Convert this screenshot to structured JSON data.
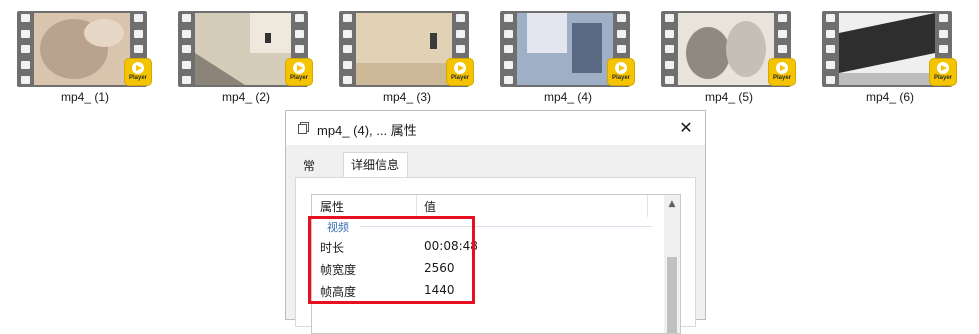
{
  "files": [
    {
      "name": "mp4_ (1)",
      "frame_colors": [
        "#d9c4ae",
        "#b9a38f",
        "#e6d7c6"
      ]
    },
    {
      "name": "mp4_ (2)",
      "frame_colors": [
        "#d6ccba",
        "#8c8478",
        "#efe8dc"
      ]
    },
    {
      "name": "mp4_ (3)",
      "frame_colors": [
        "#e1d1b5",
        "#cdb998",
        "#3b3b3b"
      ]
    },
    {
      "name": "mp4_ (4)",
      "frame_colors": [
        "#9fb0c6",
        "#e3e6ee",
        "#5a6a84"
      ]
    },
    {
      "name": "mp4_ (5)",
      "frame_colors": [
        "#e9e4da",
        "#8f8a80",
        "#c5c0b6"
      ]
    },
    {
      "name": "mp4_ (6)",
      "frame_colors": [
        "#2e2e2e",
        "#efefef",
        "#bdbdbd"
      ]
    }
  ],
  "badge": {
    "label": "Player",
    "color": "#f5c400"
  },
  "dialog": {
    "title": "mp4_ (4), ... 属性",
    "close_glyph": "✕",
    "tabs": [
      {
        "label": "常规",
        "active": false
      },
      {
        "label": "详细信息",
        "active": true
      }
    ],
    "list": {
      "header_property": "属性",
      "header_value": "值",
      "group_label": "视频",
      "rows": [
        {
          "name": "时长",
          "value": "00:08:48"
        },
        {
          "name": "帧宽度",
          "value": "2560"
        },
        {
          "name": "帧高度",
          "value": "1440"
        }
      ]
    },
    "scroll_up_glyph": "▲"
  },
  "highlight_color": "#e8101e",
  "icons": [
    "file-properties-icon",
    "close-icon",
    "play-icon",
    "scroll-up-icon"
  ]
}
